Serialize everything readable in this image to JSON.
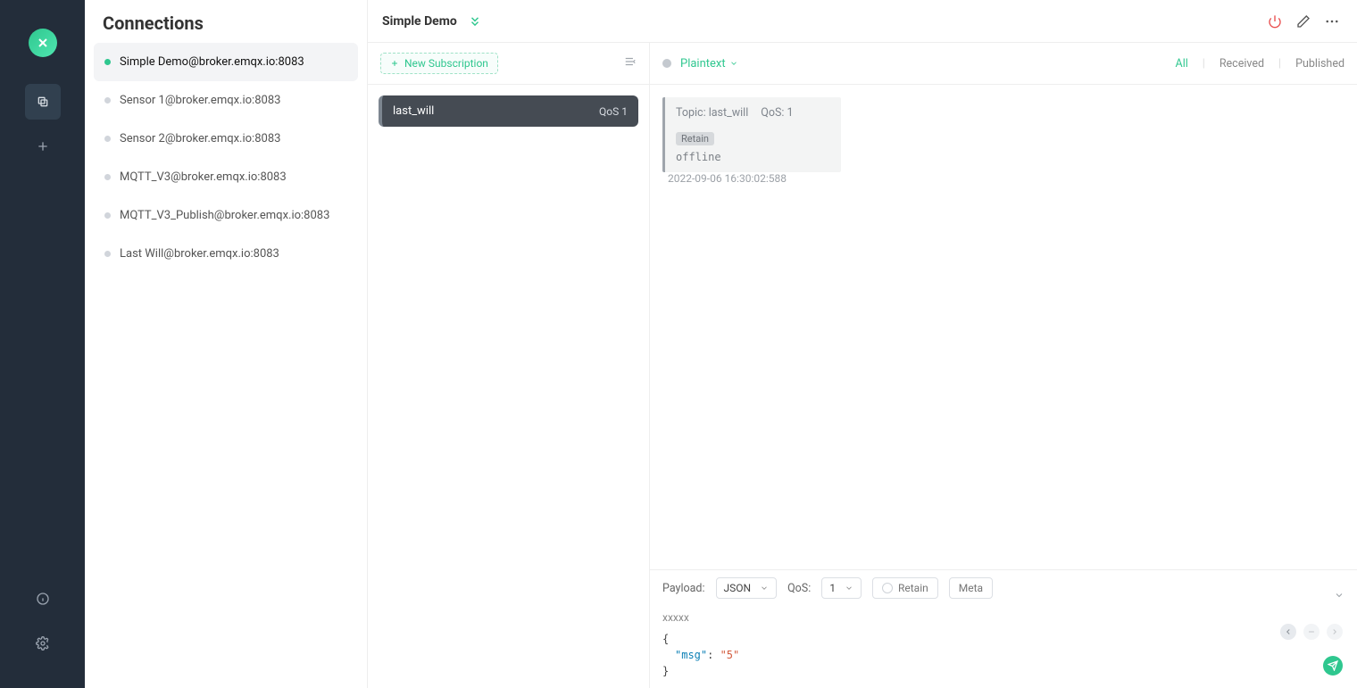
{
  "rail": {
    "logo_alt": "MQTTX"
  },
  "sidebar": {
    "title": "Connections",
    "items": [
      {
        "label": "Simple Demo@broker.emqx.io:8083",
        "online": true,
        "selected": true
      },
      {
        "label": "Sensor 1@broker.emqx.io:8083",
        "online": false,
        "selected": false
      },
      {
        "label": "Sensor 2@broker.emqx.io:8083",
        "online": false,
        "selected": false
      },
      {
        "label": "MQTT_V3@broker.emqx.io:8083",
        "online": false,
        "selected": false
      },
      {
        "label": "MQTT_V3_Publish@broker.emqx.io:8083",
        "online": false,
        "selected": false
      },
      {
        "label": "Last Will@broker.emqx.io:8083",
        "online": false,
        "selected": false
      }
    ]
  },
  "topbar": {
    "title": "Simple Demo"
  },
  "subs": {
    "new_label": "New Subscription",
    "items": [
      {
        "topic": "last_will",
        "qos_label": "QoS 1"
      }
    ]
  },
  "messages": {
    "format_label": "Plaintext",
    "filters": {
      "all": "All",
      "received": "Received",
      "published": "Published"
    },
    "active_filter": "all",
    "list": [
      {
        "topic_label": "Topic: last_will",
        "qos_label": "QoS: 1",
        "retain_label": "Retain",
        "body": "offline",
        "timestamp": "2022-09-06 16:30:02:588"
      }
    ]
  },
  "publisher": {
    "payload_label": "Payload:",
    "payload_format": "JSON",
    "qos_label": "QoS:",
    "qos_value": "1",
    "retain_label": "Retain",
    "meta_label": "Meta",
    "topic_placeholder": "xxxxx",
    "body_lines": {
      "open": "{",
      "key": "\"msg\"",
      "colon": ": ",
      "value": "\"5\"",
      "close": "}"
    }
  }
}
